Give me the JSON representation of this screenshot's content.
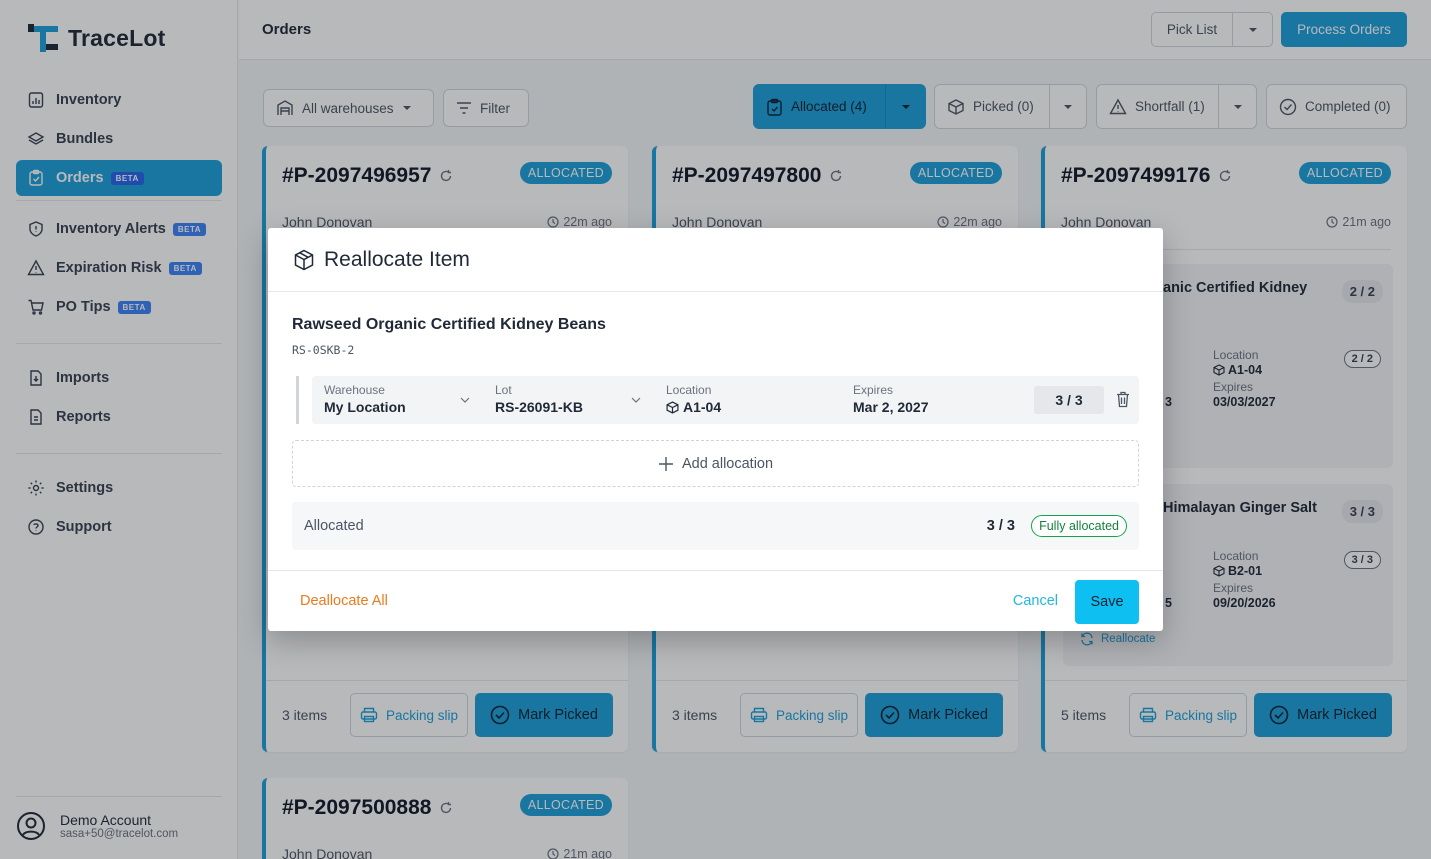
{
  "app": {
    "name": "TraceLot"
  },
  "sidebar": {
    "items": [
      {
        "label": "Inventory",
        "icon": "inventory-icon",
        "badge": ""
      },
      {
        "label": "Bundles",
        "icon": "layers-icon",
        "badge": ""
      },
      {
        "label": "Orders",
        "icon": "clipboard-icon",
        "badge": "BETA",
        "active": true
      },
      {
        "label": "Inventory Alerts",
        "icon": "shield-icon",
        "badge": "BETA"
      },
      {
        "label": "Expiration Risk",
        "icon": "warning-icon",
        "badge": "BETA"
      },
      {
        "label": "PO Tips",
        "icon": "cart-icon",
        "badge": "BETA"
      },
      {
        "label": "Imports",
        "icon": "file-import-icon",
        "badge": ""
      },
      {
        "label": "Reports",
        "icon": "file-report-icon",
        "badge": ""
      },
      {
        "label": "Settings",
        "icon": "gear-icon",
        "badge": ""
      },
      {
        "label": "Support",
        "icon": "help-icon",
        "badge": ""
      }
    ],
    "account": {
      "name": "Demo Account",
      "email": "sasa+50@tracelot.com"
    }
  },
  "header": {
    "title": "Orders",
    "pick_list_label": "Pick List",
    "process_orders_label": "Process Orders"
  },
  "filters": {
    "warehouse": "All warehouses",
    "filter_label": "Filter",
    "tabs": [
      {
        "label": "Allocated (4)",
        "active": true
      },
      {
        "label": "Picked (0)"
      },
      {
        "label": "Shortfall (1)"
      },
      {
        "label": "Completed (0)"
      }
    ]
  },
  "orders": [
    {
      "id": "#P-2097496957",
      "status": "ALLOCATED",
      "customer": "John Donovan",
      "time": "22m ago",
      "items_count": "3 items"
    },
    {
      "id": "#P-2097497800",
      "status": "ALLOCATED",
      "customer": "John Donovan",
      "time": "22m ago",
      "items_count": "3 items"
    },
    {
      "id": "#P-2097499176",
      "status": "ALLOCATED",
      "customer": "John Donovan",
      "time": "21m ago",
      "items_count": "5 items"
    },
    {
      "id": "#P-2097500888",
      "status": "ALLOCATED",
      "customer": "John Donovan",
      "time": "21m ago"
    }
  ],
  "card_actions": {
    "packing_slip": "Packing slip",
    "mark_picked": "Mark Picked",
    "reallocate": "Reallocate"
  },
  "card3_lines": [
    {
      "name": "anic Certified Kidney",
      "qty": "2 / 2",
      "qty_small": "2 / 2",
      "location_label": "Location",
      "location": "A1-04",
      "expires_label": "Expires",
      "expires": "03/03/2027",
      "left_fragment": "3"
    },
    {
      "name": "Himalayan Ginger Salt",
      "qty": "3 / 3",
      "qty_small": "3 / 3",
      "location_label": "Location",
      "location": "B2-01",
      "expires_label": "Expires",
      "expires": "09/20/2026",
      "left_fragment": "5"
    }
  ],
  "modal": {
    "title": "Reallocate Item",
    "product_name": "Rawseed Organic Certified Kidney Beans",
    "sku": "RS-0SKB-2",
    "allocation": {
      "warehouse_label": "Warehouse",
      "warehouse": "My Location",
      "lot_label": "Lot",
      "lot": "RS-26091-KB",
      "location_label": "Location",
      "location": "A1-04",
      "expires_label": "Expires",
      "expires": "Mar 2, 2027",
      "qty": "3 / 3"
    },
    "add_allocation": "Add allocation",
    "summary_label": "Allocated",
    "summary_value": "3 / 3",
    "summary_status": "Fully allocated",
    "deallocate_all": "Deallocate All",
    "cancel": "Cancel",
    "save": "Save"
  },
  "colors": {
    "brand": "#1ba0d8",
    "save": "#0ec0f2",
    "deallocate": "#ea7b1c",
    "success": "#16a34a"
  }
}
